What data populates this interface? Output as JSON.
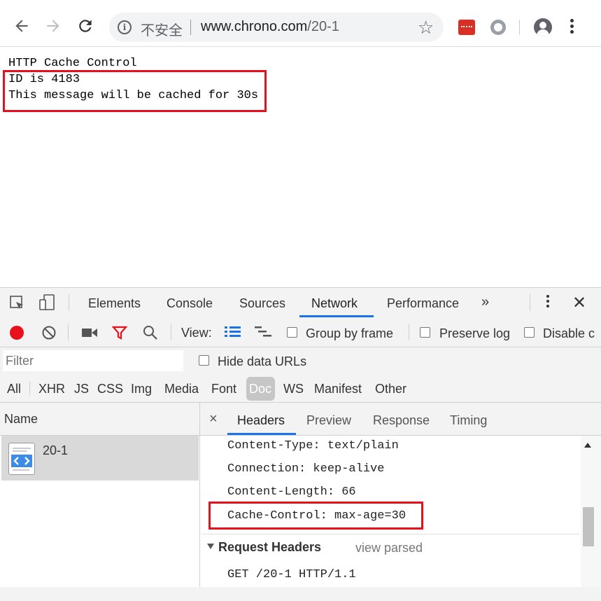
{
  "browser": {
    "back_icon": "arrow-left-icon",
    "forward_icon": "arrow-right-icon",
    "reload_icon": "reload-icon",
    "security_label": "不安全",
    "url_host": "www.chrono.com",
    "url_path": "/20-1",
    "bookmark_icon": "star-icon"
  },
  "page": {
    "line1": "HTTP Cache Control",
    "line2": "ID is 4183",
    "line3": "This message will be cached for 30s"
  },
  "devtools": {
    "tabs": [
      "Elements",
      "Console",
      "Sources",
      "Network",
      "Performance"
    ],
    "active_tab": "Network",
    "more_tabs": "»",
    "close": "✕"
  },
  "network": {
    "view_label": "View:",
    "group_by_frame": "Group by frame",
    "preserve_log": "Preserve log",
    "disable_cache": "Disable c",
    "filter_placeholder": "Filter",
    "hide_data_urls": "Hide data URLs",
    "types": [
      "All",
      "XHR",
      "JS",
      "CSS",
      "Img",
      "Media",
      "Font",
      "Doc",
      "WS",
      "Manifest",
      "Other"
    ],
    "active_type": "Doc",
    "name_header": "Name",
    "requests": [
      {
        "name": "20-1"
      }
    ]
  },
  "details": {
    "close": "×",
    "tabs": [
      "Headers",
      "Preview",
      "Response",
      "Timing"
    ],
    "active_tab": "Headers",
    "response_headers": [
      "Content-Type: text/plain",
      "Connection: keep-alive",
      "Content-Length: 66",
      "Cache-Control: max-age=30"
    ],
    "request_headers_title": "Request Headers",
    "view_parsed": "view parsed",
    "request_line": "GET /20-1 HTTP/1.1"
  },
  "colors": {
    "highlight": "#e8101b",
    "accent": "#1a73e8",
    "record": "#e8101b"
  }
}
